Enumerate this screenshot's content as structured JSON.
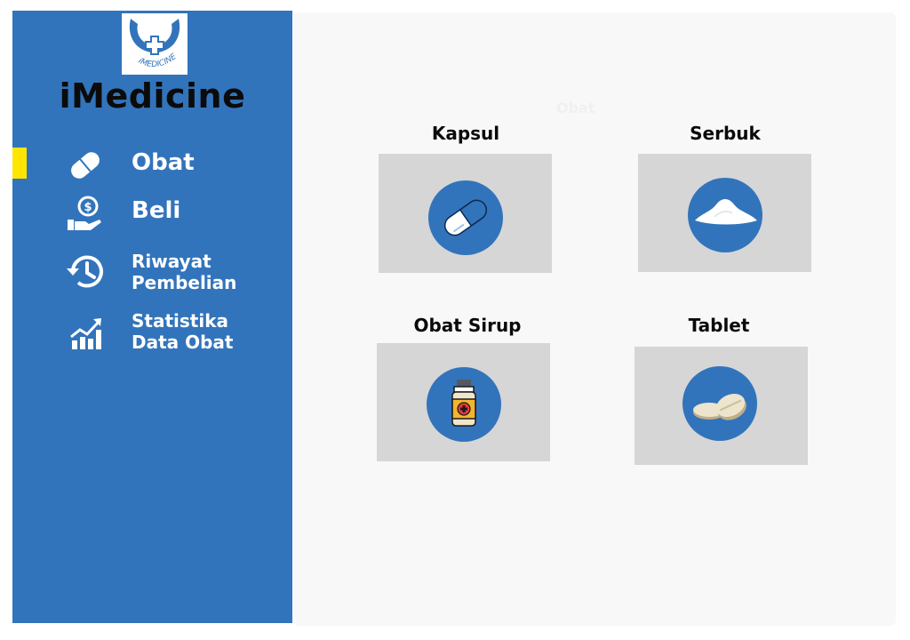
{
  "app": {
    "title": "iMedicine",
    "logo_text": "iMEDICINE"
  },
  "sidebar": {
    "items": [
      {
        "label": "Obat",
        "icon": "pill-icon",
        "active": true
      },
      {
        "label": "Beli",
        "icon": "hand-money-icon"
      },
      {
        "label_line1": "Riwayat",
        "label_line2": "Pembelian",
        "icon": "history-icon"
      },
      {
        "label_line1": "Statistika",
        "label_line2": "Data Obat",
        "icon": "chart-growth-icon"
      }
    ]
  },
  "main": {
    "ghost_text": "Obat",
    "categories": [
      {
        "title": "Kapsul",
        "icon": "capsule-icon"
      },
      {
        "title": "Serbuk",
        "icon": "powder-icon"
      },
      {
        "title": "Obat Sirup",
        "icon": "syrup-bottle-icon"
      },
      {
        "title": "Tablet",
        "icon": "tablet-icon"
      }
    ]
  },
  "colors": {
    "sidebar": "#3274bb",
    "active_indicator": "#ffe600",
    "card": "#d6d6d6",
    "main_bg": "#f8f8f8"
  }
}
